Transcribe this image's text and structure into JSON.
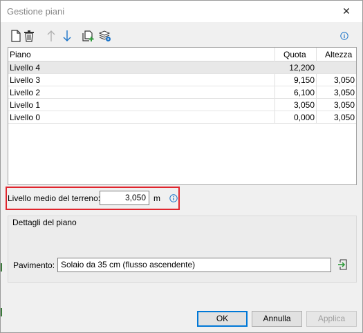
{
  "window": {
    "title": "Gestione piani",
    "close_label": "✕"
  },
  "toolbar": {
    "icons": [
      "new-document-icon",
      "delete-icon",
      "move-up-icon",
      "move-down-icon",
      "add-copy-icon",
      "layers-settings-icon",
      "info-icon"
    ]
  },
  "table": {
    "headers": {
      "name": "Piano",
      "quota": "Quota",
      "altezza": "Altezza"
    },
    "rows": [
      {
        "name": "Livello 4",
        "quota": "12,200",
        "altezza": ""
      },
      {
        "name": "Livello 3",
        "quota": "9,150",
        "altezza": "3,050"
      },
      {
        "name": "Livello 2",
        "quota": "6,100",
        "altezza": "3,050"
      },
      {
        "name": "Livello 1",
        "quota": "3,050",
        "altezza": "3,050"
      },
      {
        "name": "Livello 0",
        "quota": "0,000",
        "altezza": "3,050"
      }
    ]
  },
  "terrain": {
    "label": "Livello medio del terreno:",
    "value": "3,050",
    "unit": "m"
  },
  "details": {
    "title": "Dettagli del piano",
    "floor_label": "Pavimento:",
    "floor_value": "Solaio da 35 cm (flusso ascendente)"
  },
  "buttons": {
    "ok": "OK",
    "cancel": "Annulla",
    "apply": "Applica"
  },
  "colors": {
    "highlight": "#e0262e",
    "accent": "#0078d7",
    "icon_blue": "#1a73c8"
  }
}
